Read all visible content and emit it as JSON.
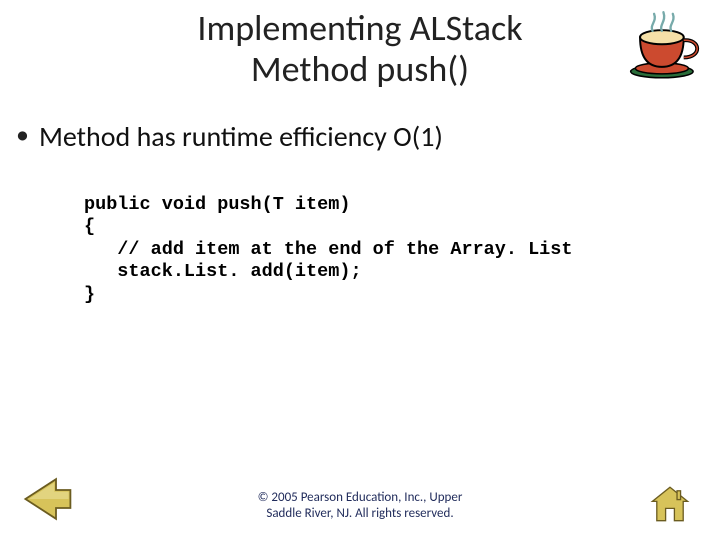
{
  "title": {
    "line1": "Implementing ALStack",
    "line2": "Method  push()"
  },
  "bullet": {
    "text": "Method has runtime efficiency O(1)"
  },
  "code": {
    "l1": "public void push(T item)",
    "l2": "{",
    "l3": "   // add item at the end of the Array. List",
    "l4": "   stack.List. add(item);",
    "l5": "}"
  },
  "footer": {
    "line1": "© 2005 Pearson Education, Inc., Upper",
    "line2": "Saddle River, NJ.  All rights reserved."
  },
  "icons": {
    "cup": "coffee-cup-icon",
    "prev": "arrow-left-icon",
    "home": "home-icon"
  }
}
